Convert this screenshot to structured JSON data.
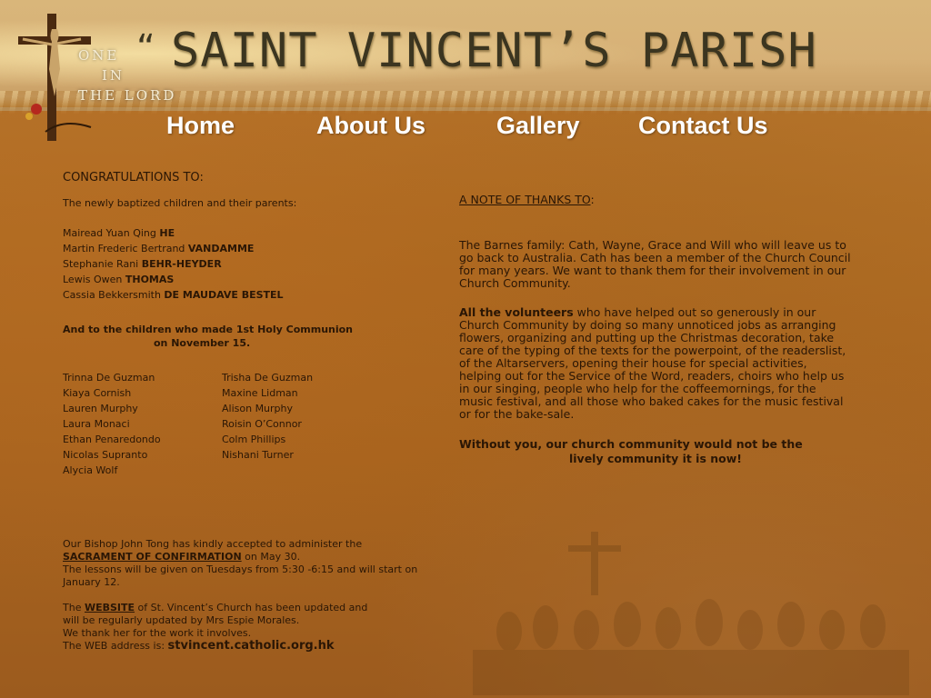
{
  "header": {
    "title": "SAINT VINCENT’S PARISH",
    "quote": "“",
    "motto": [
      "ONE",
      "IN",
      "THE LORD"
    ]
  },
  "nav": {
    "home": "Home",
    "about": "About Us",
    "gallery": "Gallery",
    "contact": "Contact Us"
  },
  "left": {
    "congrats_heading": "CONGRATULATIONS TO:",
    "baptism_intro": "The newly baptized children and their parents:",
    "baptized": [
      {
        "given": "Mairead Yuan Qing ",
        "surname": "HE"
      },
      {
        "given": "Martin Frederic Bertrand ",
        "surname": "VANDAMME"
      },
      {
        "given": "Stephanie Rani ",
        "surname": "BEHR-HEYDER"
      },
      {
        "given": "Lewis Owen ",
        "surname": "THOMAS"
      },
      {
        "given": "Cassia Bekkersmith ",
        "surname": "DE MAUDAVE BESTEL"
      }
    ],
    "communion_line1": "And to the children who made 1st Holy Communion",
    "communion_line2": "on November 15.",
    "communion_names": [
      [
        "Trinna De Guzman",
        "Trisha De Guzman"
      ],
      [
        "Kiaya Cornish",
        "Maxine Lidman"
      ],
      [
        "Lauren Murphy",
        "Alison Murphy"
      ],
      [
        "Laura Monaci",
        "Roisin O’Connor"
      ],
      [
        "Ethan Penaredondo",
        "Colm Phillips"
      ],
      [
        "Nicolas Supranto",
        "Nishani Turner"
      ],
      [
        "Alycia Wolf",
        ""
      ]
    ],
    "confirmation": {
      "line1": "Our Bishop John Tong has kindly accepted to administer the",
      "sacrament": "SACRAMENT OF CONFIRMATION",
      "date": " on May 30.",
      "line3": "The lessons will be given on Tuesdays from 5:30 -6:15 and will start on",
      "line4": "January 12."
    },
    "website": {
      "pre": "The ",
      "word": "WEBSITE",
      "line1_rest": " of St. Vincent’s Church has been updated and",
      "line2": "will be regularly updated by Mrs Espie Morales.",
      "line3": "We thank her for the work it involves.",
      "line4": "The WEB address is: ",
      "url": "stvincent.catholic.org.hk"
    }
  },
  "right": {
    "thanks_heading": "A NOTE OF THANKS TO",
    "thanks_colon": ":",
    "barnes": "The Barnes family: Cath, Wayne, Grace and Will who will leave us to go back to Australia. Cath has been a member of the Church Council for many years. We want to thank them for their involvement in our Church Community.",
    "volunteers_bold": "All the volunteers",
    "volunteers_rest": " who have helped out so generously in our Church Community by doing so many unnoticed jobs as arranging flowers, organizing and putting up the Christmas decoration, take care of the typing of the texts for the powerpoint, of the readerslist, of the Altarservers, opening their house for special activities, helping out for the Service of the Word, readers, choirs who help us in our singing, people who help for the coffeemornings, for the music festival, and all those who baked cakes for the music festival or for the bake-sale.",
    "closing1": "Without you, our church community would not be the",
    "closing2": "lively community it is now!"
  }
}
